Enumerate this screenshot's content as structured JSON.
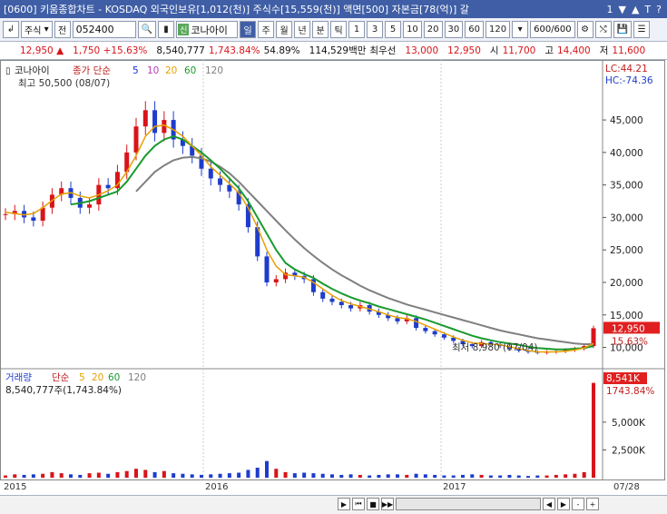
{
  "window": {
    "title": "[0600] 키움종합차트 - KOSDAQ 외국인보유[1,012(천)] 주식수[15,559(천)] 액면[500] 자본금[78(억)] 갈",
    "title_icons": [
      "1",
      "▼",
      "▲",
      "T",
      "?"
    ]
  },
  "toolbar": {
    "market": "주식",
    "all_label": "전",
    "code": "052400",
    "name_badge": "신",
    "name": "코나아이",
    "periods": [
      "일",
      "주",
      "월",
      "년",
      "분",
      "틱"
    ],
    "active_period": "일",
    "intervals": [
      "1",
      "3",
      "5",
      "10",
      "20",
      "30",
      "60",
      "120"
    ],
    "counter": "600",
    "counter_total": "/600"
  },
  "price_bar": {
    "price": "12,950",
    "change": "1,750",
    "rate": "+15.63%",
    "volume": "8,540,777",
    "vol_rate": "1,743.84%",
    "pct": "54.89%",
    "amount": "114,529백만",
    "best_ask_label": "최우선",
    "best_ask": "13,000",
    "best_bid": "12,950",
    "open_label": "시",
    "open": "11,700",
    "high_label": "고",
    "high": "14,400",
    "low_label": "저",
    "low": "11,600"
  },
  "chart_data": {
    "type": "candlestick",
    "legend_price": {
      "name": "코나아이",
      "ma_label": "종가 단순",
      "periods": [
        "5",
        "10",
        "20",
        "60",
        "120"
      ]
    },
    "legend_volume": {
      "name": "거래량",
      "ma_label": "단순",
      "periods": [
        "5",
        "20",
        "60",
        "120"
      ],
      "value_text": "8,540,777주(1,743.84%)"
    },
    "high_marker": "최고 50,500 (08/07)",
    "low_marker": "최저 8,980 (07/04)",
    "lc": "LC:44.21",
    "hc": "HC:-74.36",
    "y_ticks": [
      "45,000",
      "40,000",
      "35,000",
      "30,000",
      "25,000",
      "20,000",
      "15,000",
      "10,000"
    ],
    "y_values": [
      45000,
      40000,
      35000,
      30000,
      25000,
      20000,
      15000,
      10000
    ],
    "ylim": [
      7000,
      52000
    ],
    "current_price": "12,950",
    "current_rate": "15.63%",
    "vol_ticks": [
      "5,000K",
      "2,500K"
    ],
    "vol_values": [
      5000,
      2500
    ],
    "vol_ylim": [
      0,
      9000
    ],
    "current_volume": "8,541K",
    "current_vol_rate": "1743.84%",
    "x_labels": [
      "2015",
      "2016",
      "2017"
    ],
    "last_date": "07/28",
    "close": [
      30500,
      31000,
      30000,
      29500,
      31500,
      33500,
      34500,
      33000,
      31500,
      32000,
      35000,
      34500,
      37000,
      40000,
      44000,
      46500,
      43000,
      45000,
      42000,
      41000,
      39500,
      37500,
      36000,
      35000,
      34000,
      32000,
      28500,
      24000,
      20000,
      20500,
      21500,
      21000,
      20500,
      18500,
      17500,
      17000,
      16500,
      16000,
      16500,
      15500,
      15000,
      14500,
      14000,
      14500,
      13000,
      12500,
      12000,
      11500,
      11000,
      10500,
      10200,
      10800,
      10500,
      10200,
      9800,
      9500,
      9300,
      9200,
      9300,
      9400,
      9600,
      9800,
      10200,
      12950
    ],
    "ma5": [
      30800,
      30600,
      30400,
      30600,
      31500,
      32600,
      33600,
      33800,
      33300,
      33000,
      33500,
      34100,
      35000,
      37000,
      39500,
      42500,
      44000,
      44200,
      43500,
      42500,
      41000,
      39500,
      37800,
      36500,
      35200,
      33800,
      31500,
      28500,
      25000,
      22500,
      21200,
      21000,
      20800,
      20000,
      19000,
      18000,
      17200,
      16700,
      16300,
      15900,
      15500,
      15000,
      14600,
      14400,
      14000,
      13400,
      12800,
      12200,
      11600,
      11100,
      10700,
      10600,
      10500,
      10400,
      10100,
      9800,
      9500,
      9300,
      9300,
      9300,
      9400,
      9600,
      9900,
      10600
    ],
    "ma20": [
      null,
      null,
      null,
      null,
      null,
      null,
      null,
      32000,
      32200,
      32500,
      33000,
      33500,
      34000,
      35500,
      37500,
      39500,
      41000,
      42000,
      42500,
      42000,
      41000,
      40000,
      38800,
      37500,
      36000,
      34500,
      32500,
      30000,
      27500,
      25000,
      23000,
      22000,
      21300,
      20700,
      19800,
      19000,
      18300,
      17700,
      17200,
      16800,
      16300,
      15900,
      15500,
      15100,
      14700,
      14300,
      13800,
      13300,
      12800,
      12300,
      11800,
      11400,
      11100,
      10800,
      10600,
      10400,
      10100,
      9900,
      9800,
      9700,
      9700,
      9800,
      9900,
      10200
    ],
    "ma60": [
      null,
      null,
      null,
      null,
      null,
      null,
      null,
      null,
      null,
      null,
      null,
      null,
      null,
      null,
      34000,
      35500,
      37000,
      38000,
      38800,
      39200,
      39300,
      39100,
      38600,
      37800,
      36800,
      35500,
      34000,
      32500,
      31000,
      29500,
      28000,
      26600,
      25300,
      24100,
      23000,
      22000,
      21100,
      20300,
      19500,
      18800,
      18200,
      17600,
      17100,
      16600,
      16200,
      15800,
      15400,
      15000,
      14600,
      14200,
      13800,
      13400,
      13000,
      12600,
      12300,
      12000,
      11700,
      11400,
      11200,
      11000,
      10800,
      10600,
      10500,
      10500
    ],
    "volume": [
      200,
      300,
      250,
      300,
      350,
      500,
      400,
      300,
      250,
      400,
      450,
      350,
      500,
      600,
      800,
      700,
      500,
      600,
      400,
      350,
      300,
      250,
      300,
      350,
      400,
      450,
      700,
      900,
      1500,
      800,
      500,
      400,
      450,
      400,
      350,
      300,
      250,
      300,
      250,
      200,
      250,
      300,
      300,
      250,
      350,
      300,
      250,
      200,
      200,
      250,
      300,
      250,
      200,
      200,
      250,
      200,
      150,
      200,
      200,
      250,
      300,
      350,
      500,
      8541
    ],
    "colors": {
      "ma5": "#1a2fd6",
      "ma10": "#b93ab5",
      "ma20": "#e9a000",
      "ma60": "#1a9a2e",
      "ma120": "#7f7f7f",
      "up": "#d8141a",
      "down": "#1e3ccc"
    }
  },
  "scroll": {
    "buttons": [
      "▶",
      "⏮",
      "■",
      "▶▶",
      "◀",
      "▶",
      "-",
      "+"
    ]
  }
}
